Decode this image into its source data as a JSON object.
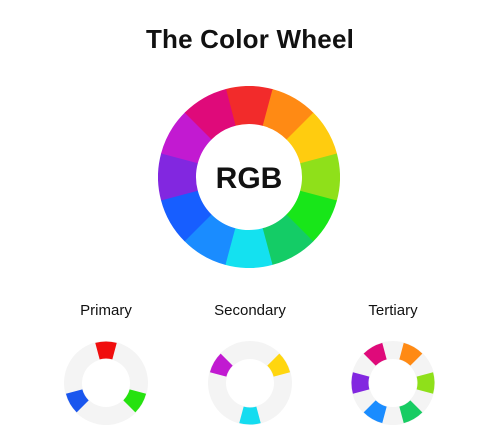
{
  "title": "The Color Wheel",
  "main_wheel": {
    "center_label": "RGB",
    "segments": [
      "#f22b2b",
      "#ff8a14",
      "#ffcc0f",
      "#8fe01a",
      "#18e619",
      "#14cc66",
      "#14e1f0",
      "#1a8cff",
      "#175eff",
      "#8227e0",
      "#c21ad1",
      "#df0a7a"
    ]
  },
  "sub_wheels": [
    {
      "label": "Primary",
      "track_color": "#f4f4f4",
      "active": {
        "0": "#f00d0d",
        "4": "#25e20f",
        "8": "#1a56ee"
      }
    },
    {
      "label": "Secondary",
      "track_color": "#f4f4f4",
      "active": {
        "2": "#ffd60f",
        "6": "#14dcf0",
        "10": "#c11ad1"
      }
    },
    {
      "label": "Tertiary",
      "track_color": "#f4f4f4",
      "active": {
        "1": "#ff8a14",
        "3": "#8fe01a",
        "5": "#18cc63",
        "7": "#1a8cff",
        "9": "#8227e0",
        "11": "#df0a7a"
      }
    }
  ]
}
